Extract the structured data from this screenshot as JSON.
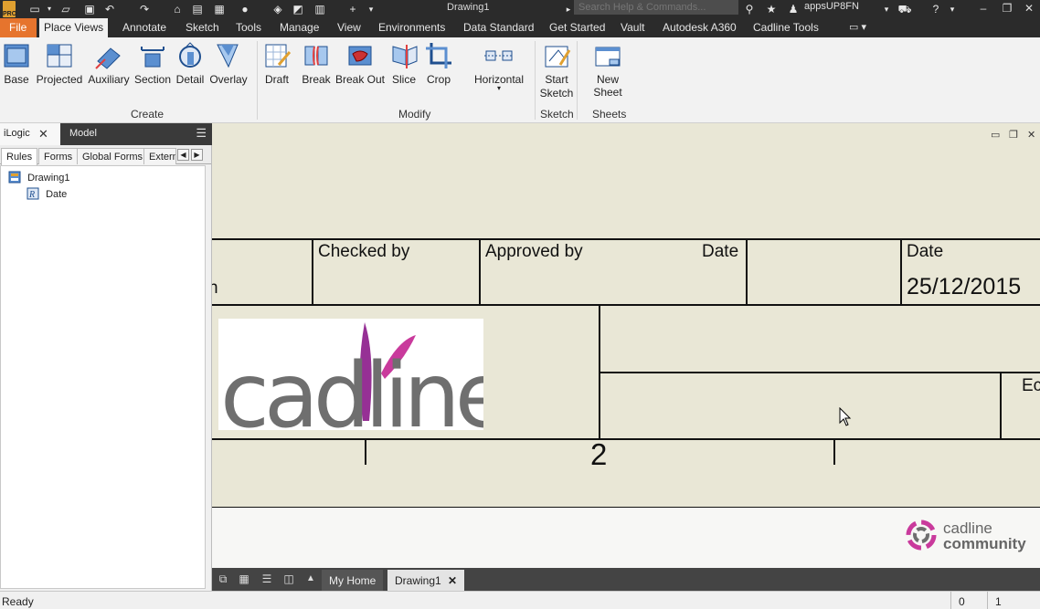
{
  "title_bar": {
    "document": "Drawing1",
    "search_placeholder": "Search Help & Commands...",
    "user": "appsUP8FN",
    "app_badge": "PRO"
  },
  "tabs": [
    "File",
    "Place Views",
    "Annotate",
    "Sketch",
    "Tools",
    "Manage",
    "View",
    "Environments",
    "Data Standard",
    "Get Started",
    "Vault",
    "Autodesk A360",
    "Cadline Tools"
  ],
  "active_tab": "Place Views",
  "ribbon": {
    "create_label": "Create",
    "modify_label": "Modify",
    "sketch_label": "Sketch",
    "sheets_label": "Sheets",
    "create": [
      "Base",
      "Projected",
      "Auxiliary",
      "Section",
      "Detail",
      "Overlay"
    ],
    "modify": [
      "Draft",
      "Break",
      "Break Out",
      "Slice",
      "Crop"
    ],
    "horizontal": "Horizontal",
    "start_sketch": [
      "Start",
      "Sketch"
    ],
    "new_sheet": "New Sheet"
  },
  "browser": {
    "panel_tab": "iLogic",
    "model_tab": "Model",
    "subtabs": [
      "Rules",
      "Forms",
      "Global Forms",
      "Extern"
    ],
    "tree": {
      "root": "Drawing1",
      "child": "Date"
    }
  },
  "drawing": {
    "checked_by": "Checked by",
    "approved_by": "Approved by",
    "date_inner": "Date",
    "date_label": "Date",
    "date_value": "25/12/2015",
    "partial_left": "n",
    "partial_right": "Ec",
    "sheet_number": "2",
    "logo_text": "cadline",
    "community_line1": "cadline",
    "community_line2": "community"
  },
  "doc_tabs": {
    "home": "My Home",
    "doc": "Drawing1"
  },
  "status": {
    "text": "Ready",
    "count1": "0",
    "count2": "1"
  },
  "colors": {
    "file_tab": "#e6742d",
    "dark_chrome": "#2b2b2b",
    "sheet": "#e9e7d6",
    "logo_purple": "#8b1a8a"
  }
}
